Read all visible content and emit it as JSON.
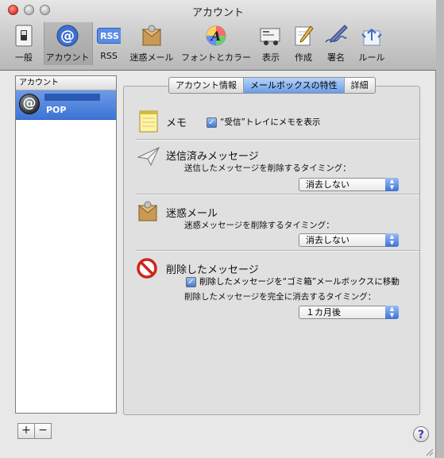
{
  "window": {
    "title": "アカウント"
  },
  "toolbar": {
    "items": [
      {
        "label": "一般"
      },
      {
        "label": "アカウント"
      },
      {
        "label": "RSS"
      },
      {
        "label": "迷惑メール"
      },
      {
        "label": "フォントとカラー"
      },
      {
        "label": "表示"
      },
      {
        "label": "作成"
      },
      {
        "label": "署名"
      },
      {
        "label": "ルール"
      }
    ],
    "rss_badge": "RSS",
    "at_glyph": "@"
  },
  "sidebar": {
    "header": "アカウント",
    "account": {
      "type": "POP",
      "avatar_glyph": "@"
    },
    "add_label": "+",
    "remove_label": "−"
  },
  "tabs": [
    {
      "label": "アカウント情報"
    },
    {
      "label": "メールボックスの特性"
    },
    {
      "label": "詳細"
    }
  ],
  "sections": {
    "memo": {
      "title": "メモ",
      "checkbox_label": "“受信”トレイにメモを表示",
      "checked": true
    },
    "sent": {
      "title": "送信済みメッセージ",
      "subtitle": "送信したメッセージを削除するタイミング：",
      "select_value": "消去しない"
    },
    "junk": {
      "title": "迷惑メール",
      "subtitle": "迷惑メッセージを削除するタイミング：",
      "select_value": "消去しない"
    },
    "deleted": {
      "title": "削除したメッセージ",
      "checkbox_label": "削除したメッセージを“ゴミ箱”メールボックスに移動",
      "checked": true,
      "subtitle": "削除したメッセージを完全に消去するタイミング：",
      "select_value": "１カ月後"
    }
  },
  "help_label": "?",
  "colors": {
    "selection": "#3c74d6",
    "tab_selected": "#6a9de9",
    "close": "#e0443a"
  }
}
